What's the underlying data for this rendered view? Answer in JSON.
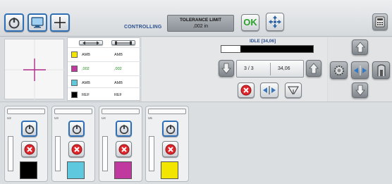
{
  "toolbar": {
    "status": "CONTROLLING",
    "tolerance_title": "TOLERANCE LIMIT",
    "tolerance_value": ",002 in",
    "ok_label": "OK"
  },
  "colors": [
    {
      "name": "yellow",
      "hex": "#f2e600",
      "value1": "AMB",
      "value2": "AMB",
      "green": false
    },
    {
      "name": "magenta",
      "hex": "#c0399e",
      "value1": ",002",
      "value2": ",002",
      "green": true
    },
    {
      "name": "cyan",
      "hex": "#5ec8de",
      "value1": "AMB",
      "value2": "AMB",
      "green": false
    },
    {
      "name": "black",
      "hex": "#000000",
      "value1": "REF",
      "value2": "REF",
      "green": false
    }
  ],
  "status": {
    "idle_label": "IDLE [34,06]",
    "progress_fraction": 0.21,
    "page_count": "3 / 3",
    "page_value": "34,06"
  },
  "units": [
    {
      "label": "U2",
      "color": "#000000"
    },
    {
      "label": "U3",
      "color": "#5ec8de"
    },
    {
      "label": "U4",
      "color": "#c0399e"
    },
    {
      "label": "U5",
      "color": "#f2e600"
    }
  ]
}
